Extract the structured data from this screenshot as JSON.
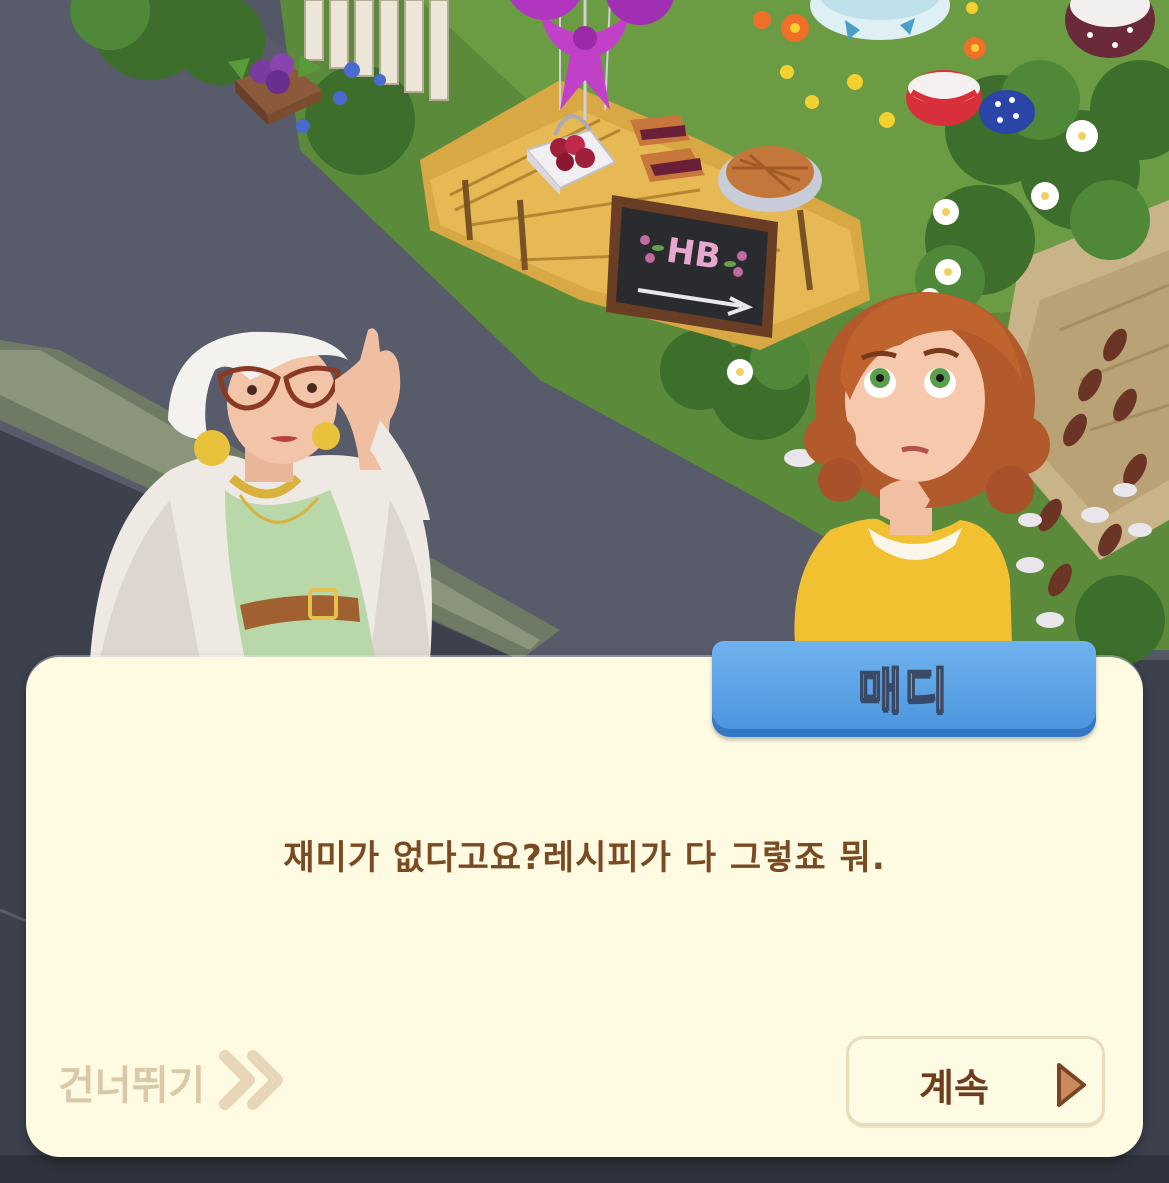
{
  "speaker": {
    "name": "매디"
  },
  "dialog": {
    "text": "재미가 없다고요?레시피가 다 그렇죠 뭐."
  },
  "controls": {
    "skip_label": "건너뛰기",
    "continue_label": "계속"
  },
  "scene": {
    "sign_text": "HB"
  },
  "icons": {
    "skip": "double-chevron-right-icon",
    "continue": "play-triangle-icon"
  },
  "colors": {
    "dialog_bg": "#fefbe2",
    "name_tag": "#4a93dc",
    "dialog_text": "#7a4a22",
    "skip_text": "#d9c9a9",
    "continue_text": "#6e3e1c",
    "arrow": "#c98a5e"
  }
}
